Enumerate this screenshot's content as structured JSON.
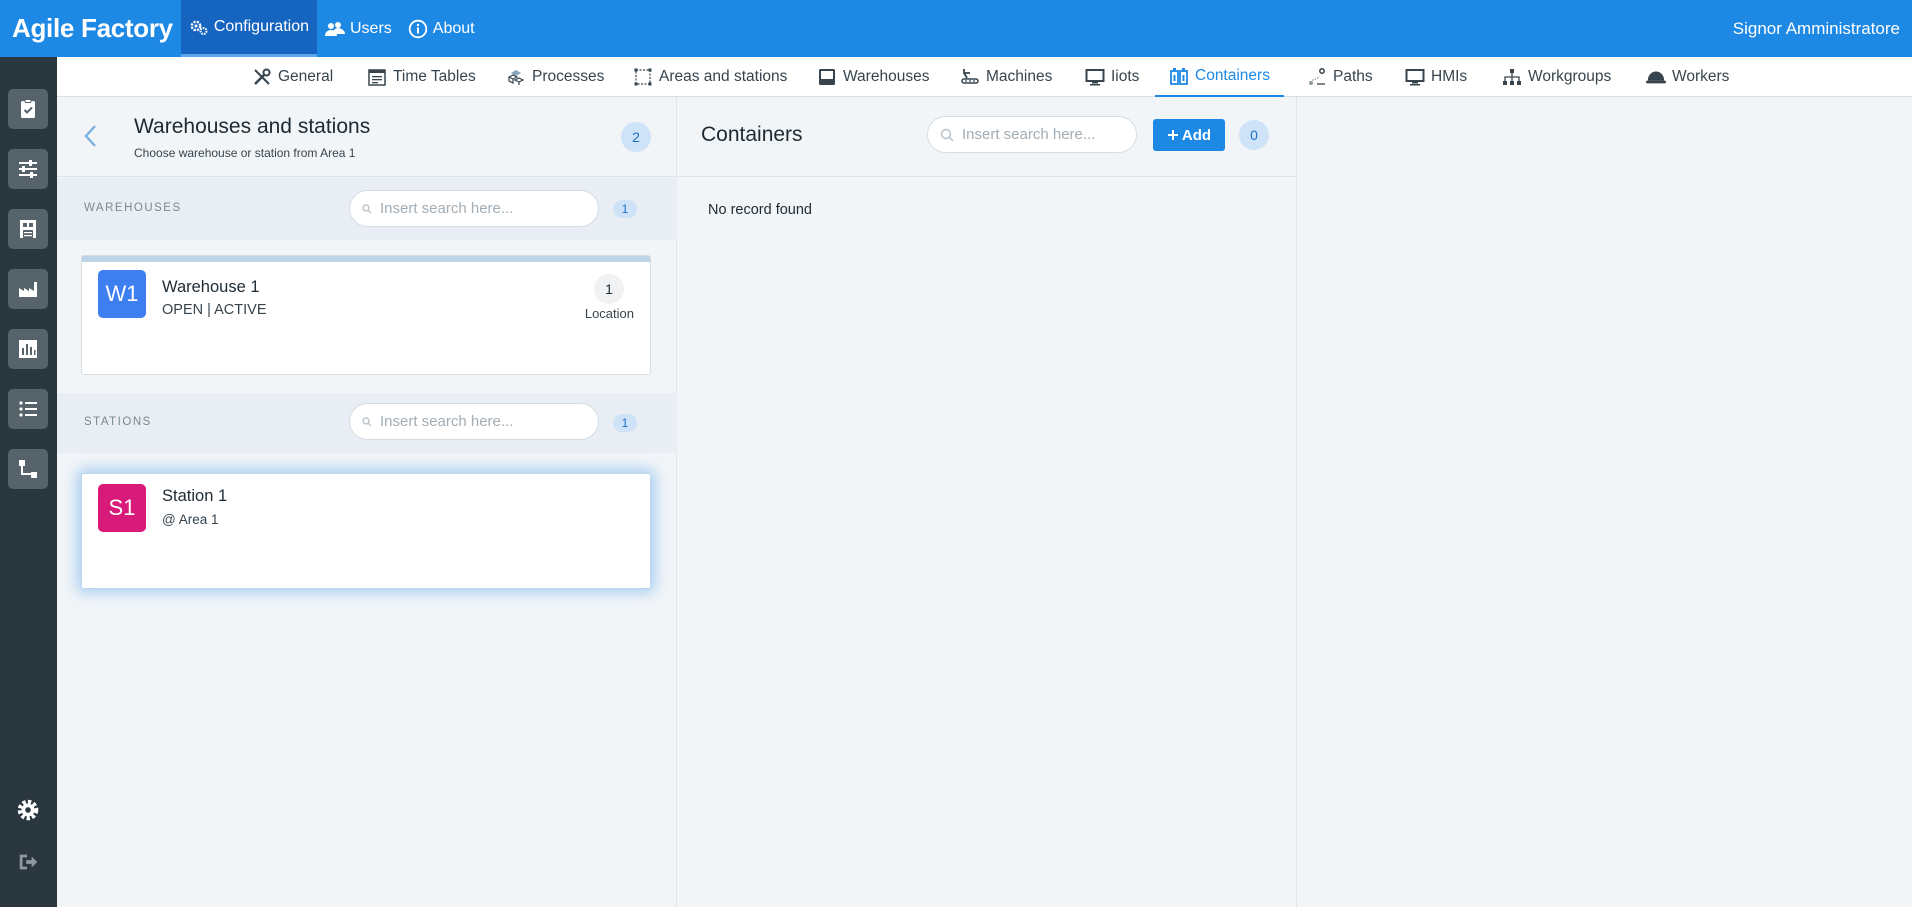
{
  "app": {
    "title": "Agile Factory"
  },
  "topnav": {
    "items": [
      {
        "label": "Configuration",
        "icon": "gears-icon",
        "active": true
      },
      {
        "label": "Users",
        "icon": "users-icon",
        "active": false
      },
      {
        "label": "About",
        "icon": "info-icon",
        "active": false
      }
    ],
    "user_name": "Signor Amministratore"
  },
  "rail": {
    "items": [
      "checklist-icon",
      "sliders-icon",
      "warehouse-icon",
      "factory-icon",
      "bar-chart-icon",
      "list-icon",
      "flow-icon"
    ],
    "bottom": [
      "gear-icon",
      "logout-icon"
    ]
  },
  "subnav": {
    "items": [
      {
        "label": "General",
        "icon": "tools-icon"
      },
      {
        "label": "Time Tables",
        "icon": "calendar-icon"
      },
      {
        "label": "Processes",
        "icon": "cubes-icon"
      },
      {
        "label": "Areas and stations",
        "icon": "area-icon"
      },
      {
        "label": "Warehouses",
        "icon": "inbox-icon"
      },
      {
        "label": "Machines",
        "icon": "machine-icon"
      },
      {
        "label": "Iiots",
        "icon": "monitor-icon"
      },
      {
        "label": "Containers",
        "icon": "containers-icon"
      },
      {
        "label": "Paths",
        "icon": "path-icon"
      },
      {
        "label": "HMIs",
        "icon": "monitor-icon"
      },
      {
        "label": "Workgroups",
        "icon": "sitemap-icon"
      },
      {
        "label": "Workers",
        "icon": "helmet-icon"
      }
    ],
    "active": "Containers"
  },
  "left_panel": {
    "title": "Warehouses and stations",
    "subtitle": "Choose warehouse or station from Area 1",
    "count": "2",
    "warehouses": {
      "label": "WAREHOUSES",
      "search_placeholder": "Insert search here...",
      "count": "1",
      "items": [
        {
          "initials": "W1",
          "name": "Warehouse 1",
          "status": "OPEN | ACTIVE",
          "location_count": "1",
          "location_label": "Location",
          "color": "#3d7ef0"
        }
      ]
    },
    "stations": {
      "label": "STATIONS",
      "search_placeholder": "Insert search here...",
      "count": "1",
      "items": [
        {
          "initials": "S1",
          "name": "Station 1",
          "area": "@ Area 1",
          "color": "#d81b7b"
        }
      ]
    }
  },
  "mid_panel": {
    "title": "Containers",
    "search_placeholder": "Insert search here...",
    "add_label": "Add",
    "count": "0",
    "empty_text": "No record found"
  },
  "colors": {
    "primary": "#1e88e5",
    "rail": "#2b373f",
    "topbar_active": "#1565c0"
  }
}
